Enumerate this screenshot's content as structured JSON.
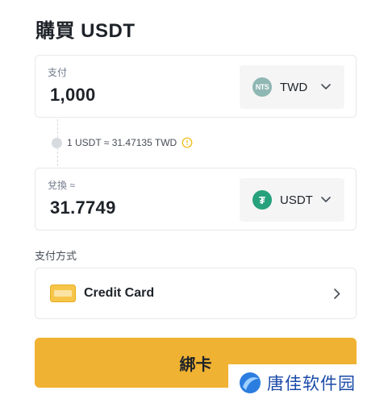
{
  "page": {
    "title": "購買 USDT"
  },
  "pay": {
    "label": "支付",
    "amount": "1,000",
    "currency": {
      "code": "TWD",
      "icon_text": "NTS",
      "icon": "twd-coin-icon"
    }
  },
  "rate": {
    "text": "1 USDT ≈ 31.47135 TWD"
  },
  "receive": {
    "label": "兌換 ≈",
    "amount": "31.7749",
    "currency": {
      "code": "USDT",
      "icon_text": "₮",
      "icon": "usdt-coin-icon"
    }
  },
  "payment_method": {
    "label": "支付方式",
    "selected": "Credit Card",
    "icon": "credit-card-icon"
  },
  "action": {
    "button_label": "綁卡"
  },
  "watermark": {
    "text": "唐佳软件园"
  },
  "colors": {
    "accent": "#f0b232",
    "usdt": "#26a17b",
    "twd": "#8fb7b3",
    "info": "#f0b90b",
    "watermark": "#1a4aa8"
  }
}
